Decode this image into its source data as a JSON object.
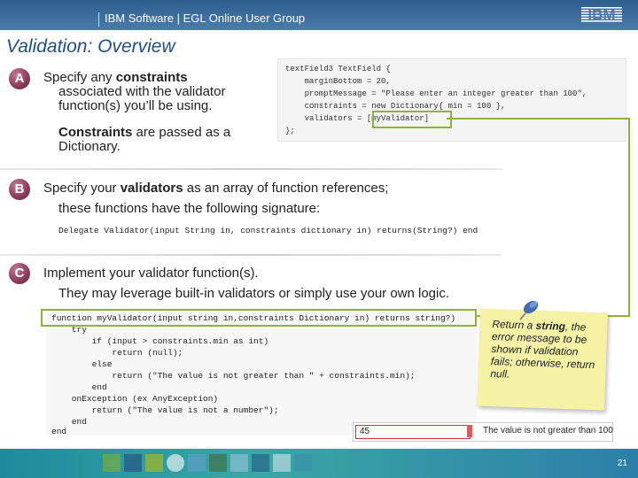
{
  "header": {
    "title": "IBM Software | EGL Online User Group",
    "logo": "IBM"
  },
  "slide_title": "Validation:  Overview",
  "sections": [
    {
      "badge": "A",
      "line1_prefix": "Specify any ",
      "line1_bold": "constraints",
      "line2": "associated with the validator",
      "line3": "function(s) you’ll be using.",
      "line4_bold": "Constraints",
      "line4_rest": " are passed as a",
      "line5": "Dictionary."
    },
    {
      "badge": "B",
      "line1_prefix": "Specify your ",
      "line1_bold": "validators",
      "line1_rest": " as an array of function references;",
      "line2": "these functions have the following signature:",
      "signature": "Delegate Validator(input String in, constraints dictionary in) returns(String?) end"
    },
    {
      "badge": "C",
      "line1": "Implement your validator function(s).",
      "line2": "They may leverage built-in validators or simply use your own logic."
    }
  ],
  "code_a": [
    "textField3 TextField {",
    "    marginBottom = 20,",
    "    promptMessage = \"Please enter an integer greater than 100\",",
    "    constraints = new Dictionary{ min = 100 },",
    "    validators = [myValidator]",
    "};"
  ],
  "code_c": [
    "function myValidator(input string in,constraints Dictionary in) returns string?)",
    "    try",
    "        if (input > constraints.min as int)",
    "            return (null);",
    "        else",
    "            return (\"The value is not greater than \" + constraints.min);",
    "        end",
    "    onException (ex AnyException)",
    "        return (\"The value is not a number\");",
    "    end",
    "end"
  ],
  "note": {
    "pre": "Return a ",
    "bold": "string",
    "post": ", the error message to be shown if validation fails; otherwise, return null."
  },
  "result": {
    "input_value": "45",
    "message": "The value is not greater than 100"
  },
  "footer": {
    "page_number": "21"
  },
  "colors": {
    "accent_green": "#8fb33a",
    "title_blue": "#1f4f8a",
    "badge": "#8a3a5a",
    "note_yellow": "#f5f2a6"
  }
}
